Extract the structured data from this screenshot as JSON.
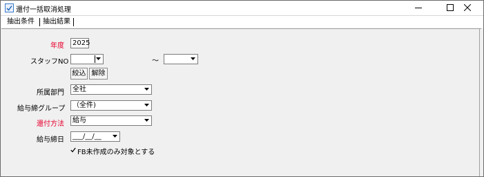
{
  "window": {
    "title": "還付一括取消処理",
    "minimize_icon": "minimize-icon",
    "maximize_icon": "maximize-icon",
    "close_icon": "close-icon"
  },
  "tabs": [
    {
      "label": "抽出条件",
      "selected": true
    },
    {
      "label": "抽出結果",
      "selected": false
    }
  ],
  "form": {
    "year_label": "年度",
    "year_value": "2025",
    "staff_label": "スタッフNO",
    "staff_from_value": "",
    "range_separator": "～",
    "staff_to_value": "",
    "narrow_button": "絞込",
    "clear_button": "解除",
    "dept_label": "所属部門",
    "dept_value": "全社",
    "payroll_group_label": "給与締グループ",
    "payroll_group_value": "（全件)",
    "refund_method_label": "還付方法",
    "refund_method_value": "給与",
    "closing_date_label": "給与締日",
    "closing_date_value": "___/__/__",
    "fb_checkbox_label": "FB未作成のみ対象とする",
    "fb_checkbox_checked": true
  },
  "colors": {
    "required_label": "#e8002d"
  }
}
